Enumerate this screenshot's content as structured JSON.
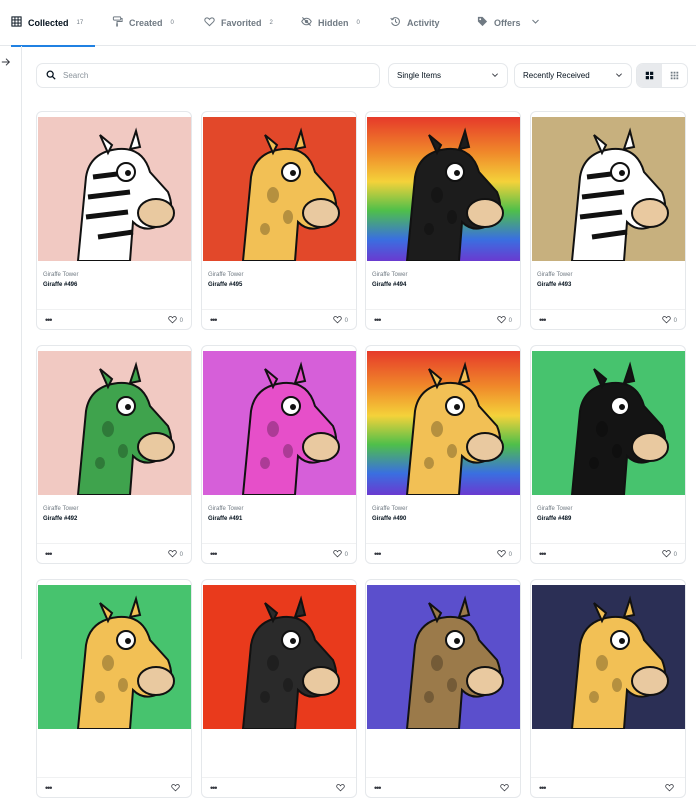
{
  "tabs": [
    {
      "label": "Collected",
      "count": "17",
      "icon": "grid-icon"
    },
    {
      "label": "Created",
      "count": "0",
      "icon": "brush-icon"
    },
    {
      "label": "Favorited",
      "count": "2",
      "icon": "heart-icon"
    },
    {
      "label": "Hidden",
      "count": "0",
      "icon": "eye-off-icon"
    },
    {
      "label": "Activity",
      "count": "",
      "icon": "history-icon"
    },
    {
      "label": "Offers",
      "count": "",
      "icon": "tag-icon"
    }
  ],
  "search": {
    "placeholder": "Search"
  },
  "filters": {
    "type_selected": "Single Items",
    "sort_selected": "Recently Received"
  },
  "colors": {
    "accent": "#2081e2",
    "border": "#e5e8eb",
    "muted": "#707a83"
  },
  "items": [
    {
      "collection": "Giraffe Tower",
      "name": "Giraffe #496",
      "likes": "0",
      "bg": "#f1c9c2"
    },
    {
      "collection": "Giraffe Tower",
      "name": "Giraffe #495",
      "likes": "0",
      "bg": "#e2482a"
    },
    {
      "collection": "Giraffe Tower",
      "name": "Giraffe #494",
      "likes": "0",
      "bg": "rainbow"
    },
    {
      "collection": "Giraffe Tower",
      "name": "Giraffe #493",
      "likes": "0",
      "bg": "#c7b07e"
    },
    {
      "collection": "Giraffe Tower",
      "name": "Giraffe #492",
      "likes": "0",
      "bg": "#f1c9c2"
    },
    {
      "collection": "Giraffe Tower",
      "name": "Giraffe #491",
      "likes": "0",
      "bg": "#d65fd9"
    },
    {
      "collection": "Giraffe Tower",
      "name": "Giraffe #490",
      "likes": "0",
      "bg": "rainbow"
    },
    {
      "collection": "Giraffe Tower",
      "name": "Giraffe #489",
      "likes": "0",
      "bg": "#47c36e"
    },
    {
      "collection": "",
      "name": "",
      "likes": "",
      "bg": "#47c36e"
    },
    {
      "collection": "",
      "name": "",
      "likes": "",
      "bg": "#e93a1c"
    },
    {
      "collection": "",
      "name": "",
      "likes": "",
      "bg": "#5b4fcc"
    },
    {
      "collection": "",
      "name": "",
      "likes": "",
      "bg": "#2b2f55"
    }
  ]
}
